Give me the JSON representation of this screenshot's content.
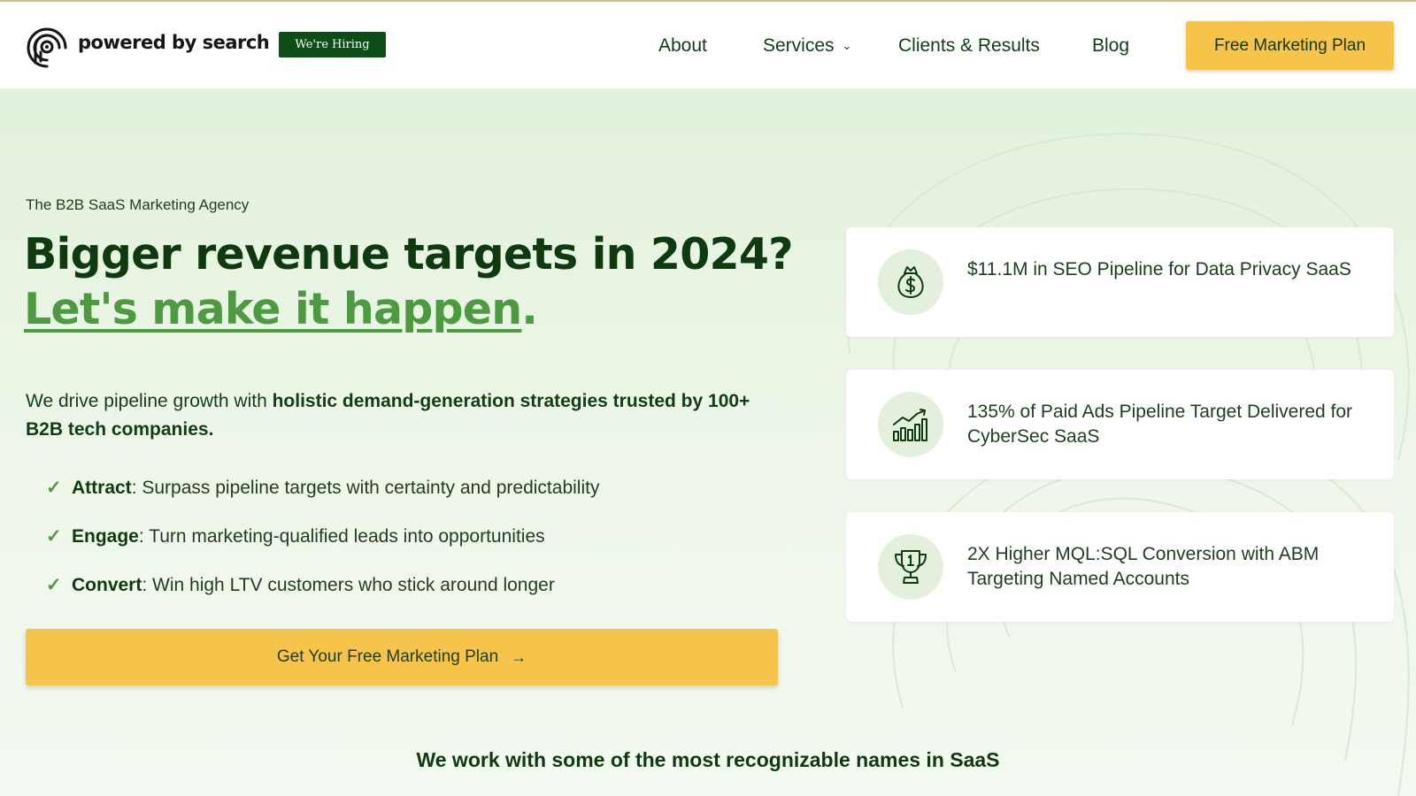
{
  "header": {
    "brand": "powered by search",
    "hiring_badge": "We're Hiring",
    "nav": {
      "about": "About",
      "services": "Services",
      "clients": "Clients & Results",
      "blog": "Blog"
    },
    "cta": "Free Marketing Plan"
  },
  "hero": {
    "eyebrow": "The B2B SaaS Marketing Agency",
    "headline_line1": "Bigger revenue targets in 2024?",
    "headline_accent": "Let's make it happen",
    "headline_punct": ".",
    "lead_plain": "We drive pipeline growth with ",
    "lead_bold": "holistic demand-generation strategies trusted by 100+ B2B tech companies.",
    "bullets": [
      {
        "term": "Attract",
        "text": ": Surpass pipeline targets with certainty and predictability"
      },
      {
        "term": "Engage",
        "text": ": Turn marketing-qualified leads into opportunities"
      },
      {
        "term": "Convert",
        "text": ": Win high LTV customers who stick around longer"
      }
    ],
    "cta": "Get Your Free Marketing Plan"
  },
  "results": [
    {
      "icon": "money-bag-icon",
      "text": "$11.1M in SEO Pipeline for Data Privacy SaaS"
    },
    {
      "icon": "bar-chart-growth-icon",
      "text": "135% of Paid Ads Pipeline Target Delivered for CyberSec SaaS"
    },
    {
      "icon": "trophy-icon",
      "text": "2X Higher MQL:SQL Conversion with ABM Targeting Named Accounts"
    }
  ],
  "clients_heading": "We work with some of the most recognizable names in SaaS",
  "colors": {
    "primary_green": "#0f3a10",
    "accent_green": "#4e9a40",
    "cta_yellow": "#f7c44b",
    "badge_green": "#0f4d18"
  }
}
